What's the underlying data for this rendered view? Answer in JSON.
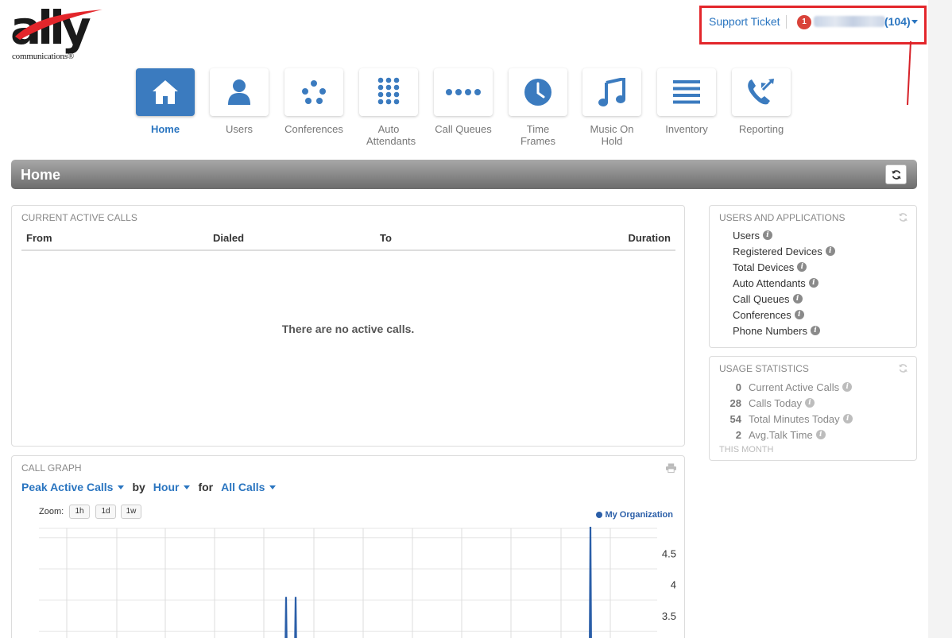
{
  "brand": {
    "name": "ally",
    "tagline": "communications",
    "mark": "®"
  },
  "account": {
    "support_link": "Support Ticket",
    "notification_count": "1",
    "user_count": "(104)"
  },
  "nav": [
    {
      "label": "Home",
      "icon": "home-icon",
      "active": true
    },
    {
      "label": "Users",
      "icon": "user-icon",
      "active": false
    },
    {
      "label": "Conferences",
      "icon": "conference-icon",
      "active": false
    },
    {
      "label": "Auto Attendants",
      "icon": "keypad-icon",
      "active": false
    },
    {
      "label": "Call Queues",
      "icon": "queue-icon",
      "active": false
    },
    {
      "label": "Time Frames",
      "icon": "clock-icon",
      "active": false
    },
    {
      "label": "Music On Hold",
      "icon": "music-icon",
      "active": false
    },
    {
      "label": "Inventory",
      "icon": "list-icon",
      "active": false
    },
    {
      "label": "Reporting",
      "icon": "phone-transfer-icon",
      "active": false
    }
  ],
  "page": {
    "title": "Home"
  },
  "active_calls": {
    "heading": "Current Active Calls",
    "columns": [
      "From",
      "Dialed",
      "To",
      "Duration"
    ],
    "empty_message": "There are no active calls."
  },
  "users_apps": {
    "heading": "Users and Applications",
    "items": [
      "Users",
      "Registered Devices",
      "Total Devices",
      "Auto Attendants",
      "Call Queues",
      "Conferences",
      "Phone Numbers"
    ]
  },
  "usage": {
    "heading": "Usage Statistics",
    "rows": [
      {
        "value": "0",
        "label": "Current Active Calls"
      },
      {
        "value": "28",
        "label": "Calls Today"
      },
      {
        "value": "54",
        "label": "Total Minutes Today"
      },
      {
        "value": "2",
        "label": "Avg.Talk Time"
      }
    ],
    "next_section": "This Month"
  },
  "call_graph": {
    "heading": "Call Graph",
    "metric": "Peak Active Calls",
    "by_word": "by",
    "interval": "Hour",
    "for_word": "for",
    "scope": "All Calls",
    "zoom_label": "Zoom:",
    "zoom_options": [
      "1h",
      "1d",
      "1w"
    ],
    "legend": "My Organization"
  },
  "chart_data": {
    "type": "line",
    "series": [
      {
        "name": "My Organization",
        "values": [
          0,
          0,
          0,
          0,
          3.8,
          0,
          3.8,
          0,
          0,
          5,
          0,
          0
        ]
      }
    ],
    "y_ticks": [
      "4.5",
      "4",
      "3.5"
    ],
    "ylim": [
      3.0,
      4.9
    ],
    "grid": true,
    "legend_position": "top-right",
    "color": "#2a5ea8"
  }
}
